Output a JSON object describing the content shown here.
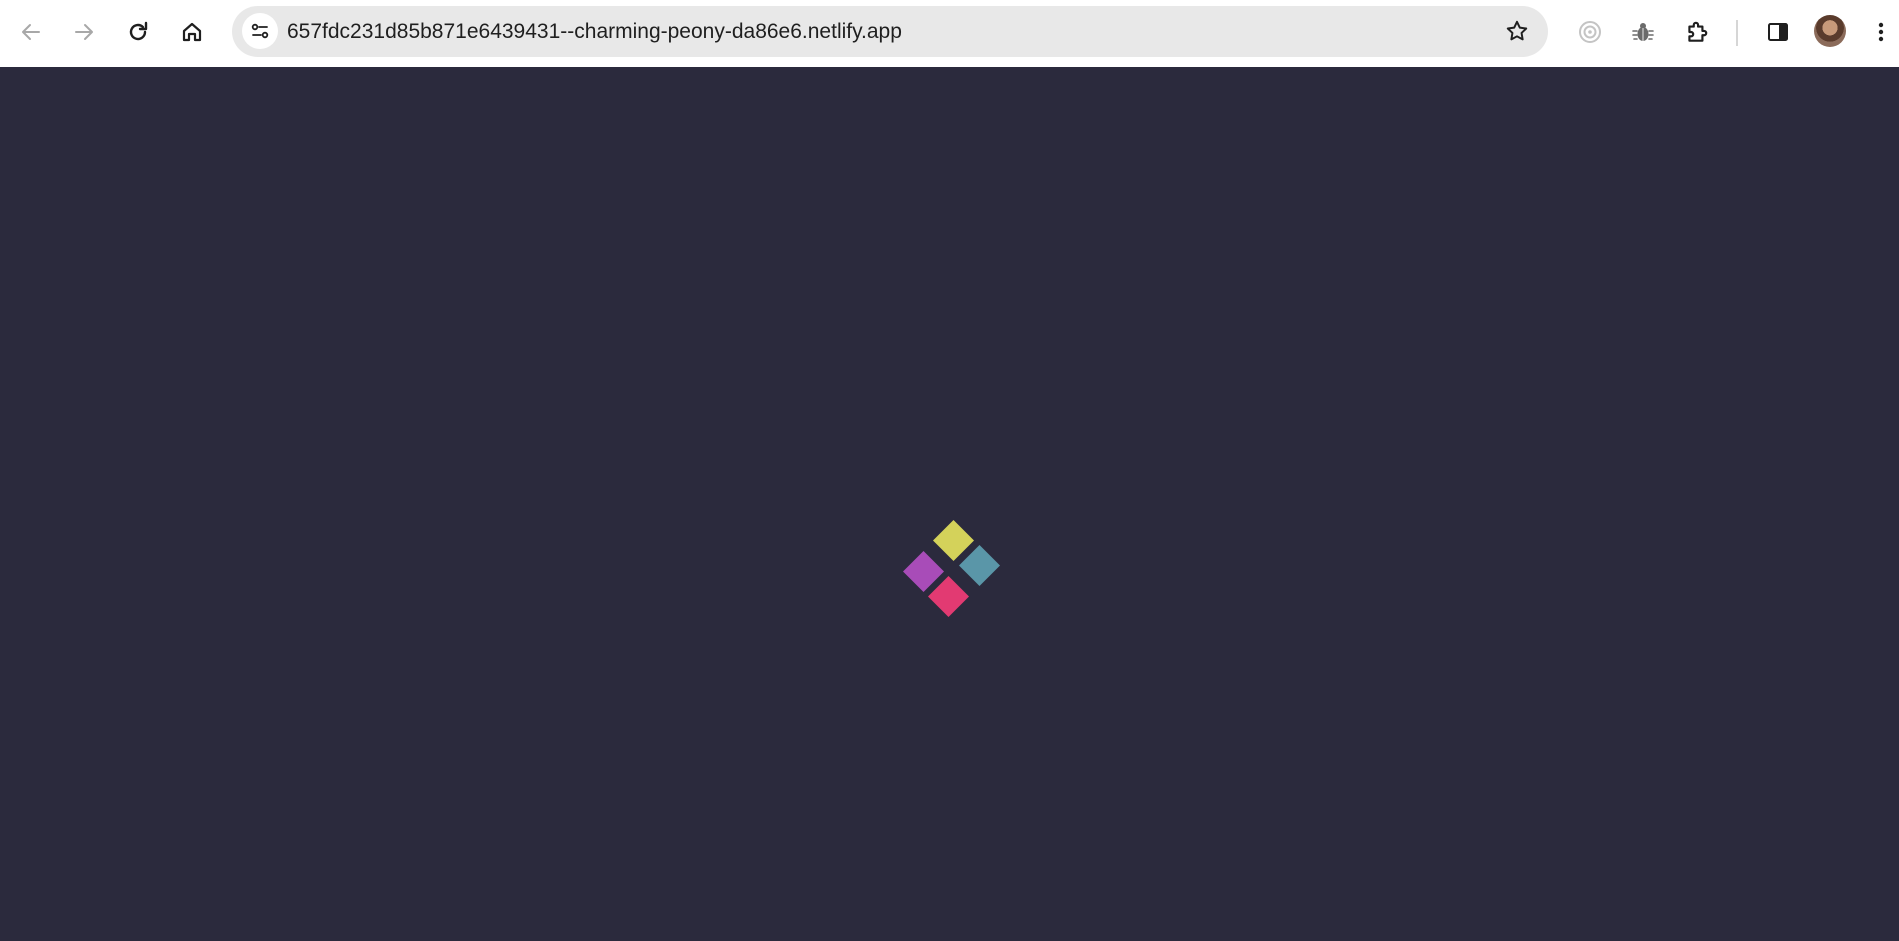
{
  "browser": {
    "url": "657fdc231d85b871e6439431--charming-peony-da86e6.netlify.app",
    "icons": {
      "back": "arrow-left-icon",
      "forward": "arrow-right-icon",
      "reload": "reload-icon",
      "home": "home-icon",
      "site_info": "tune-icon",
      "bookmark": "star-icon",
      "extension_1": "target-icon",
      "extension_2": "bug-icon",
      "extensions": "puzzle-icon",
      "side_panel": "side-panel-icon",
      "menu": "more-vert-icon"
    }
  },
  "page": {
    "background": "#2b2a3d",
    "loader_colors": {
      "top": "#d4d25a",
      "right": "#5a96a8",
      "left": "#a84cb8",
      "bottom": "#e23a72"
    }
  }
}
